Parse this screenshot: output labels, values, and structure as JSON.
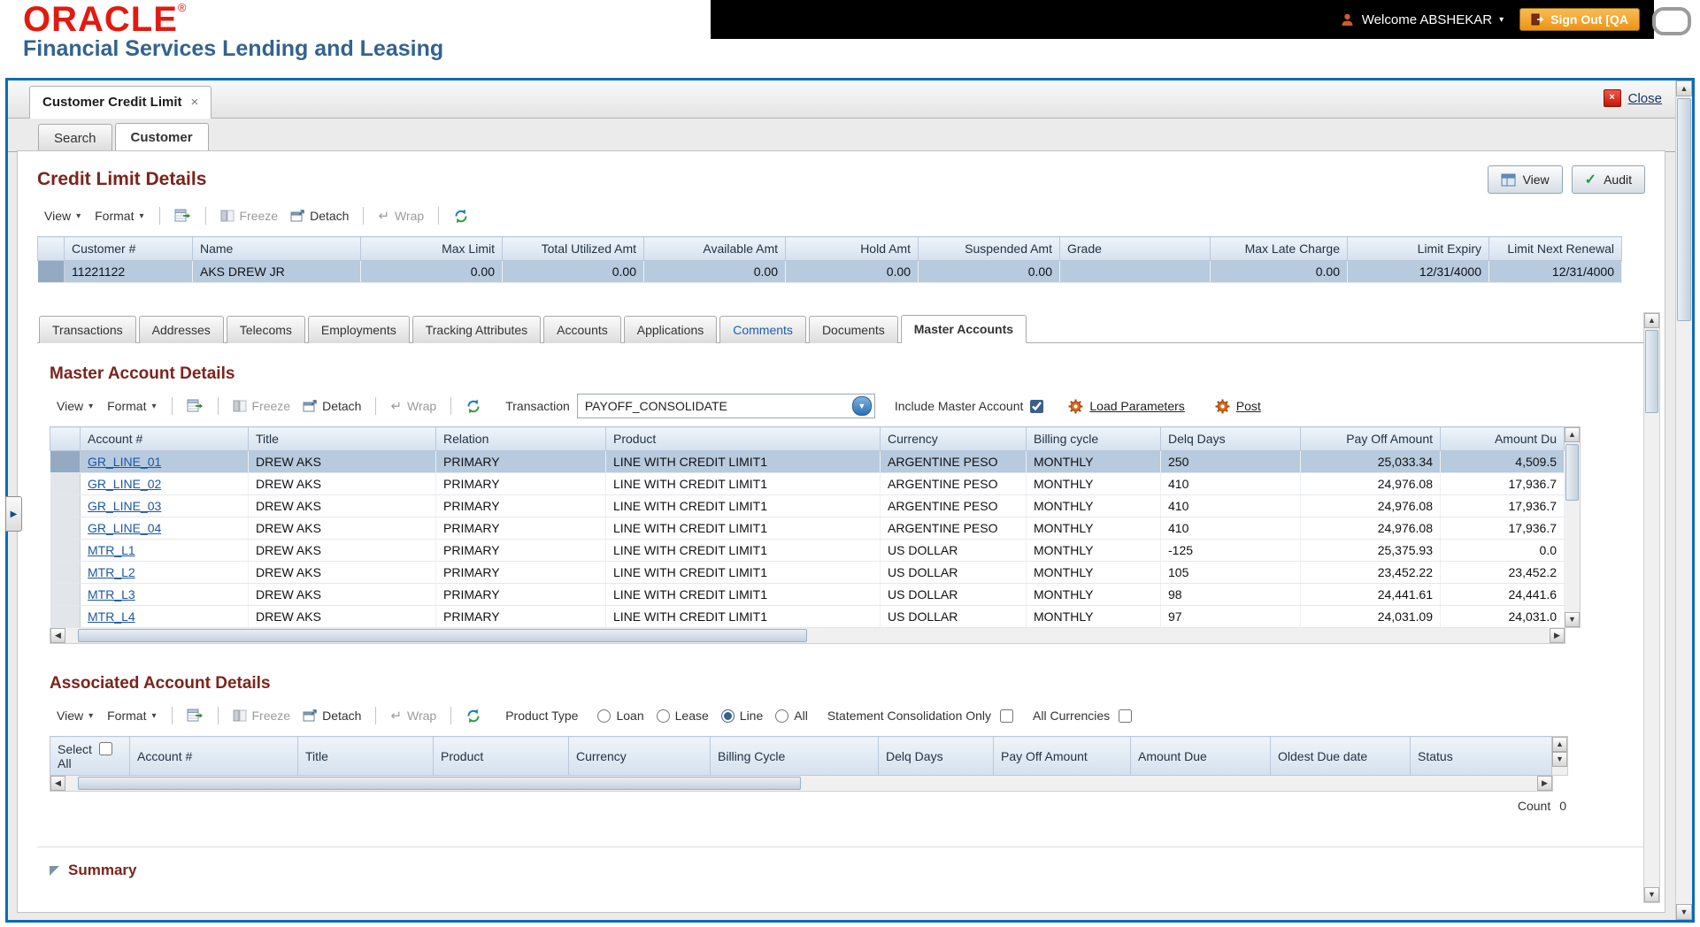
{
  "icons": {
    "caret_down": "▾",
    "up": "▲",
    "down": "▼",
    "left": "◀",
    "right": "▶",
    "close_x": "×",
    "check": "✓",
    "wrap": "↵",
    "expander": "▶"
  },
  "header": {
    "brand": "ORACLE",
    "brand_mark": "®",
    "subtitle": "Financial Services Lending and Leasing",
    "welcome": "Welcome ABSHEKAR",
    "signout": "Sign Out [QA"
  },
  "window": {
    "doc_tab": "Customer Credit Limit",
    "close": "Close"
  },
  "tabs": {
    "search": "Search",
    "customer": "Customer"
  },
  "toolbar": {
    "view": "View",
    "format": "Format",
    "freeze": "Freeze",
    "detach": "Detach",
    "wrap": "Wrap"
  },
  "credit": {
    "title": "Credit Limit Details",
    "view_btn": "View",
    "audit_btn": "Audit",
    "columns": [
      "Customer #",
      "Name",
      "Max Limit",
      "Total Utilized Amt",
      "Available Amt",
      "Hold Amt",
      "Suspended Amt",
      "Grade",
      "Max Late Charge",
      "Limit Expiry",
      "Limit Next Renewal"
    ],
    "row": [
      "11221122",
      "AKS DREW JR",
      "0.00",
      "0.00",
      "0.00",
      "0.00",
      "0.00",
      "",
      "0.00",
      "12/31/4000",
      "12/31/4000"
    ]
  },
  "subtabs": [
    "Transactions",
    "Addresses",
    "Telecoms",
    "Employments",
    "Tracking Attributes",
    "Accounts",
    "Applications",
    "Comments",
    "Documents",
    "Master Accounts"
  ],
  "master": {
    "title": "Master Account Details",
    "transaction_label": "Transaction",
    "transaction_value": "PAYOFF_CONSOLIDATE",
    "include_label": "Include Master Account",
    "load_params": "Load Parameters",
    "post": "Post",
    "columns": [
      "Account #",
      "Title",
      "Relation",
      "Product",
      "Currency",
      "Billing cycle",
      "Delq Days",
      "Pay Off Amount",
      "Amount Du"
    ],
    "rows": [
      [
        "GR_LINE_01",
        "DREW AKS",
        "PRIMARY",
        "LINE WITH CREDIT LIMIT1",
        "ARGENTINE PESO",
        "MONTHLY",
        "250",
        "25,033.34",
        "4,509.5"
      ],
      [
        "GR_LINE_02",
        "DREW AKS",
        "PRIMARY",
        "LINE WITH CREDIT LIMIT1",
        "ARGENTINE PESO",
        "MONTHLY",
        "410",
        "24,976.08",
        "17,936.7"
      ],
      [
        "GR_LINE_03",
        "DREW AKS",
        "PRIMARY",
        "LINE WITH CREDIT LIMIT1",
        "ARGENTINE PESO",
        "MONTHLY",
        "410",
        "24,976.08",
        "17,936.7"
      ],
      [
        "GR_LINE_04",
        "DREW AKS",
        "PRIMARY",
        "LINE WITH CREDIT LIMIT1",
        "ARGENTINE PESO",
        "MONTHLY",
        "410",
        "24,976.08",
        "17,936.7"
      ],
      [
        "MTR_L1",
        "DREW AKS",
        "PRIMARY",
        "LINE WITH CREDIT LIMIT1",
        "US DOLLAR",
        "MONTHLY",
        "-125",
        "25,375.93",
        "0.0"
      ],
      [
        "MTR_L2",
        "DREW AKS",
        "PRIMARY",
        "LINE WITH CREDIT LIMIT1",
        "US DOLLAR",
        "MONTHLY",
        "105",
        "23,452.22",
        "23,452.2"
      ],
      [
        "MTR_L3",
        "DREW AKS",
        "PRIMARY",
        "LINE WITH CREDIT LIMIT1",
        "US DOLLAR",
        "MONTHLY",
        "98",
        "24,441.61",
        "24,441.6"
      ],
      [
        "MTR_L4",
        "DREW AKS",
        "PRIMARY",
        "LINE WITH CREDIT LIMIT1",
        "US DOLLAR",
        "MONTHLY",
        "97",
        "24,031.09",
        "24,031.0"
      ]
    ]
  },
  "assoc": {
    "title": "Associated Account Details",
    "product_type_label": "Product Type",
    "opt_loan": "Loan",
    "opt_lease": "Lease",
    "opt_line": "Line",
    "opt_all": "All",
    "stmt_label": "Statement Consolidation Only",
    "curr_label": "All Currencies",
    "col_select": "Select",
    "col_select2": "All",
    "columns": [
      "Account #",
      "Title",
      "Product",
      "Currency",
      "Billing Cycle",
      "Delq Days",
      "Pay Off Amount",
      "Amount Due",
      "Oldest Due date",
      "Status"
    ],
    "count_label": "Count",
    "count_value": "0"
  },
  "summary": {
    "title": "Summary"
  }
}
